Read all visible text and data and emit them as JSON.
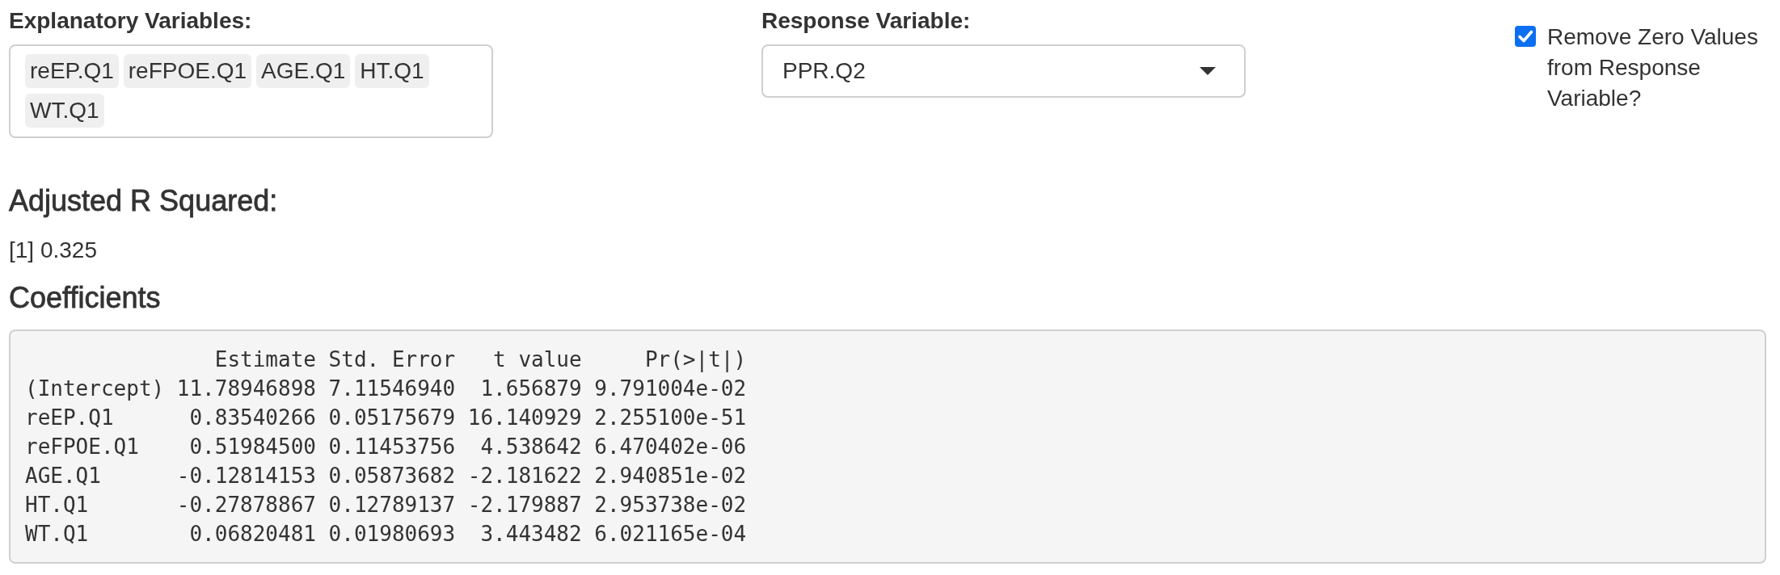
{
  "explanatory": {
    "label": "Explanatory Variables:",
    "items": [
      "reEP.Q1",
      "reFPOE.Q1",
      "AGE.Q1",
      "HT.Q1",
      "WT.Q1"
    ]
  },
  "response": {
    "label": "Response Variable:",
    "value": "PPR.Q2"
  },
  "remove_zero": {
    "label": "Remove Zero Values from Response Variable?",
    "checked": true
  },
  "adjusted_r_squared": {
    "heading": "Adjusted R Squared:",
    "output": "[1] 0.325"
  },
  "coefficients": {
    "heading": "Coefficients",
    "columns": [
      "Estimate",
      "Std. Error",
      "t value",
      "Pr(>|t|)"
    ],
    "rows": [
      {
        "name": "(Intercept)",
        "values": [
          "11.78946898",
          "7.11546940",
          "1.656879",
          "9.791004e-02"
        ]
      },
      {
        "name": "reEP.Q1",
        "values": [
          "0.83540266",
          "0.05175679",
          "16.140929",
          "2.255100e-51"
        ]
      },
      {
        "name": "reFPOE.Q1",
        "values": [
          "0.51984500",
          "0.11453756",
          "4.538642",
          "6.470402e-06"
        ]
      },
      {
        "name": "AGE.Q1",
        "values": [
          "-0.12814153",
          "0.05873682",
          "-2.181622",
          "2.940851e-02"
        ]
      },
      {
        "name": "HT.Q1",
        "values": [
          "-0.27878867",
          "0.12789137",
          "-2.179887",
          "2.953738e-02"
        ]
      },
      {
        "name": "WT.Q1",
        "values": [
          "0.06820481",
          "0.01980693",
          "3.443482",
          "6.021165e-04"
        ]
      }
    ]
  }
}
